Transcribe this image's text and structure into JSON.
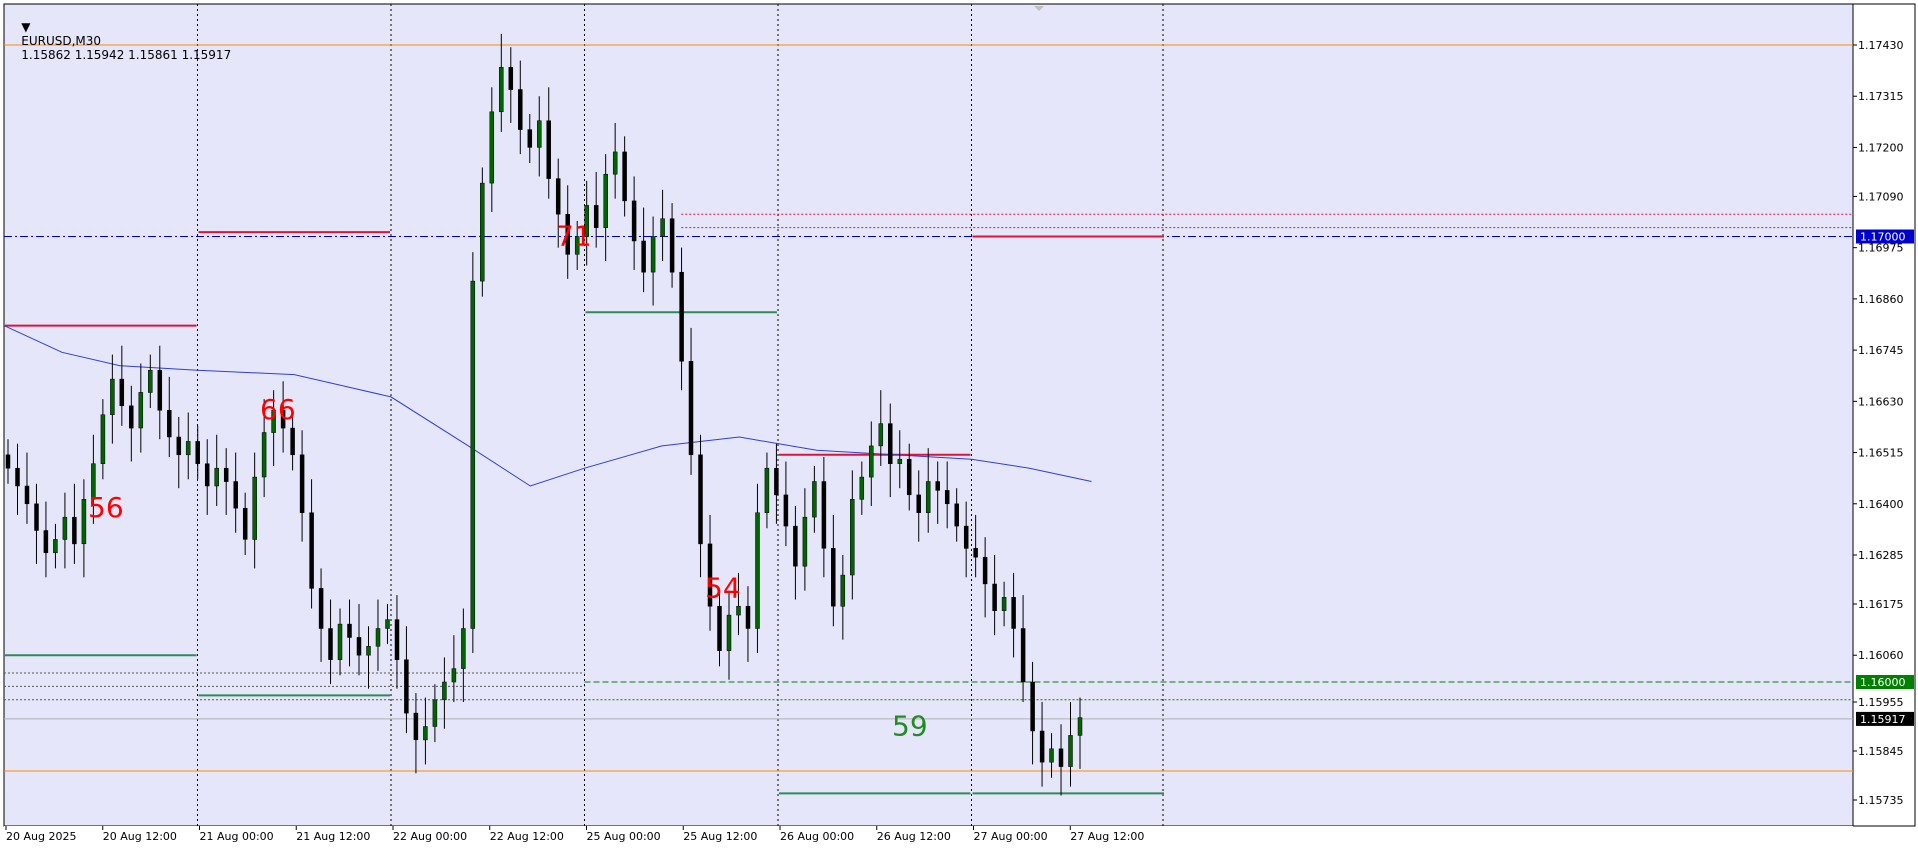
{
  "header": {
    "symbol": "EURUSD,M30",
    "ohlc": "1.15862 1.15942 1.15861 1.15917"
  },
  "colors": {
    "background": "#e6e6fa",
    "candle": "#000000",
    "bull_fill": "#006400",
    "bear_fill": "#000000",
    "ma_line": "#2f3fd0",
    "resistance": "#dc143c",
    "support": "#2e8b57",
    "orange": "#ff8c00",
    "label_red": "#ff0000",
    "label_green": "#228b22",
    "tag_blue": "#0000cd",
    "tag_green": "#008000",
    "tag_black": "#000000"
  },
  "price_axis": {
    "min": 1.1569,
    "max": 1.1749,
    "ticks": [
      "1.17430",
      "1.17315",
      "1.17200",
      "1.17090",
      "1.16975",
      "1.16860",
      "1.16745",
      "1.16630",
      "1.16515",
      "1.16400",
      "1.16285",
      "1.16175",
      "1.16060",
      "1.15955",
      "1.15845",
      "1.15735"
    ],
    "tags": [
      {
        "name": "level-1.17000-tag",
        "text": "1.17000",
        "value": 1.17,
        "kind": "blue"
      },
      {
        "name": "level-1.16000-tag",
        "text": "1.16000",
        "value": 1.16,
        "kind": "green"
      },
      {
        "name": "current-price-tag",
        "text": "1.15917",
        "value": 1.15917,
        "kind": "black"
      }
    ]
  },
  "time_axis": {
    "labels": [
      "20 Aug 2025",
      "20 Aug 12:00",
      "21 Aug 00:00",
      "21 Aug 12:00",
      "22 Aug 00:00",
      "22 Aug 12:00",
      "25 Aug 00:00",
      "25 Aug 12:00",
      "26 Aug 00:00",
      "26 Aug 12:00",
      "27 Aug 00:00",
      "27 Aug 12:00"
    ],
    "session_separators": [
      "21 Aug 00:00",
      "22 Aug 00:00",
      "25 Aug 00:00",
      "26 Aug 00:00",
      "27 Aug 00:00",
      "28 Aug 00:00"
    ]
  },
  "annotations": [
    {
      "text": "56",
      "session": 0,
      "price": 1.1637,
      "color": "red"
    },
    {
      "text": "66",
      "session": 1,
      "price": 1.1659,
      "color": "red"
    },
    {
      "text": "71",
      "session": 3,
      "price": 1.1698,
      "color": "red"
    },
    {
      "text": "54",
      "session": 4,
      "price": 1.1619,
      "color": "red"
    },
    {
      "text": "59",
      "session": 5,
      "price": 1.1588,
      "color": "green"
    }
  ],
  "levels": [
    {
      "name": "orange-top-level",
      "price": 1.1743,
      "from_session": 0,
      "to_session": 10,
      "kind": "orange"
    },
    {
      "name": "orange-bottom-level",
      "price": 1.158,
      "from_session": 0,
      "to_session": 10,
      "kind": "orange"
    },
    {
      "name": "blue-1.17-level",
      "price": 1.17,
      "from_session": 0,
      "to_session": 10,
      "kind": "blue-dash"
    },
    {
      "name": "green-1.16-level",
      "price": 1.16,
      "from_session": 3,
      "to_session": 10,
      "kind": "green-dash"
    }
  ],
  "session_highs": [
    1.168,
    1.1701,
    null,
    null,
    null,
    1.17
  ],
  "session_lows": [
    1.1606,
    1.1597,
    null,
    1.1683,
    1.1575,
    1.1575
  ],
  "ma_points": [
    [
      0,
      1.168
    ],
    [
      0.3,
      1.1674
    ],
    [
      0.6,
      1.1671
    ],
    [
      1.0,
      1.167
    ],
    [
      1.5,
      1.1669
    ],
    [
      2.0,
      1.1664
    ],
    [
      2.4,
      1.1653
    ],
    [
      2.72,
      1.1644
    ],
    [
      3.0,
      1.1648
    ],
    [
      3.4,
      1.1653
    ],
    [
      3.8,
      1.1655
    ],
    [
      4.2,
      1.1652
    ],
    [
      4.6,
      1.1651
    ],
    [
      5.0,
      1.165
    ],
    [
      5.3,
      1.1648
    ],
    [
      5.62,
      1.1645
    ]
  ],
  "candles_close": [
    1.1648,
    1.1644,
    1.164,
    1.1634,
    1.1629,
    1.1632,
    1.1637,
    1.1631,
    1.1641,
    1.1649,
    1.166,
    1.1668,
    1.1662,
    1.1657,
    1.1665,
    1.167,
    1.1661,
    1.1655,
    1.1651,
    1.1654,
    1.1649,
    1.1644,
    1.1648,
    1.1645,
    1.1639,
    1.1632,
    1.1646,
    1.1656,
    1.1661,
    1.1657,
    1.1651,
    1.1638,
    1.1621,
    1.1612,
    1.1605,
    1.1613,
    1.161,
    1.1606,
    1.1608,
    1.1612,
    1.1614,
    1.1605,
    1.1593,
    1.1587,
    1.159,
    1.1596,
    1.16,
    1.1603,
    1.1612,
    1.169,
    1.1712,
    1.1728,
    1.1738,
    1.1733,
    1.1724,
    1.172,
    1.1726,
    1.1713,
    1.1705,
    1.1696,
    1.17,
    1.1707,
    1.1702,
    1.1714,
    1.1719,
    1.1708,
    1.1699,
    1.1692,
    1.17,
    1.1704,
    1.1692,
    1.1672,
    1.1651,
    1.1631,
    1.1617,
    1.1607,
    1.1615,
    1.1617,
    1.1612,
    1.1638,
    1.1648,
    1.1642,
    1.1635,
    1.1626,
    1.1637,
    1.1645,
    1.163,
    1.1617,
    1.1624,
    1.1641,
    1.1646,
    1.1653,
    1.1658,
    1.1649,
    1.165,
    1.1642,
    1.1638,
    1.1645,
    1.1643,
    1.164,
    1.1635,
    1.163,
    1.1628,
    1.1622,
    1.1616,
    1.1619,
    1.1612,
    1.16,
    1.1589,
    1.1582,
    1.1585,
    1.1581,
    1.1588,
    1.1592
  ]
}
